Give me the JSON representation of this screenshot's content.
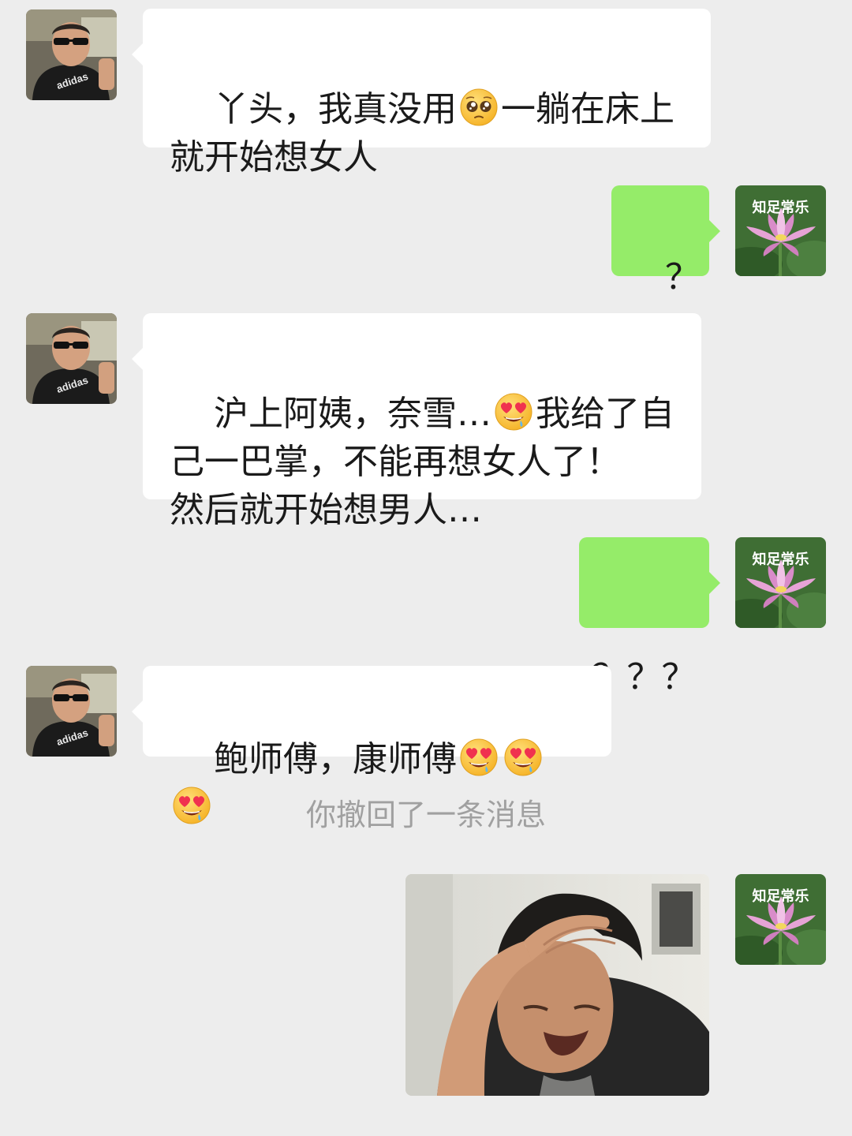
{
  "contact": {
    "avatar_icon": "man-sunglasses-car-avatar-icon",
    "shirt_text": "adidas"
  },
  "me": {
    "avatar_icon": "lotus-flower-avatar-icon",
    "avatar_caption": "知足常乐"
  },
  "messages": [
    {
      "sender": "contact",
      "segments": [
        "丫头，我真没用",
        "一躺在床上\n就开始想女人"
      ],
      "emojis": [
        "pleading-face-emoji-icon"
      ]
    },
    {
      "sender": "me",
      "text": "？"
    },
    {
      "sender": "contact",
      "segments": [
        "沪上阿姨，奈雪…",
        "我给了自\n己一巴掌，不能再想女人了！\n然后就开始想男人…"
      ],
      "emojis": [
        "heart-eyes-drooling-emoji-icon"
      ]
    },
    {
      "sender": "me",
      "text": "？？？"
    },
    {
      "sender": "contact",
      "segments": [
        "鲍师傅，康师傅"
      ],
      "emojis": [
        "heart-eyes-drooling-emoji-icon",
        "heart-eyes-drooling-emoji-icon",
        "heart-eyes-drooling-emoji-icon"
      ]
    }
  ],
  "system_notice": "你撤回了一条消息",
  "sticker": {
    "icon": "facepalm-meme-sticker-icon",
    "sender": "me"
  },
  "colors": {
    "background": "#ededed",
    "incoming_bubble": "#ffffff",
    "outgoing_bubble": "#95ec69",
    "system_text": "#a0a0a0"
  }
}
